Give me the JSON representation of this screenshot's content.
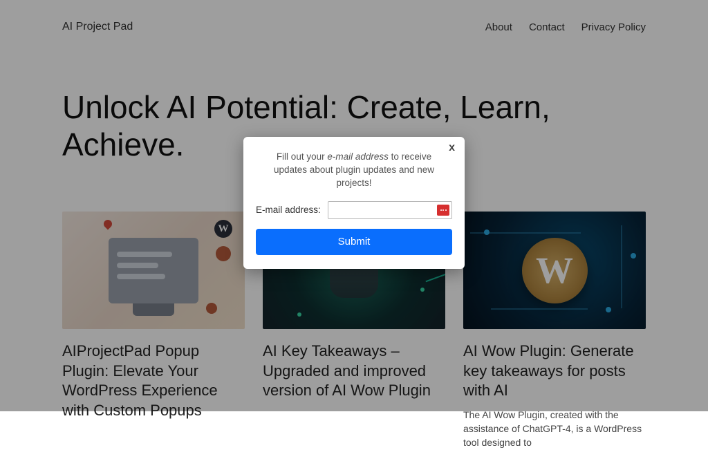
{
  "header": {
    "brand": "AI Project Pad",
    "nav": [
      "About",
      "Contact",
      "Privacy Policy"
    ]
  },
  "hero": "Unlock AI Potential: Create, Learn, Achieve.",
  "cards": [
    {
      "title": "AIProjectPad Popup Plugin: Elevate Your WordPress Experience with Custom Popups",
      "excerpt": ""
    },
    {
      "title": "AI Key Takeaways – Upgraded and improved version of AI Wow Plugin",
      "excerpt": ""
    },
    {
      "title": "AI Wow Plugin: Generate key takeaways for posts with AI",
      "excerpt": "The AI Wow Plugin, created with the assistance of ChatGPT-4, is a WordPress tool designed to"
    }
  ],
  "modal": {
    "text_pre": "Fill out your ",
    "text_em": "e-mail address",
    "text_post": " to receive updates about plugin updates and new projects!",
    "field_label": "E-mail address:",
    "field_value": "",
    "submit": "Submit",
    "close": "x"
  }
}
